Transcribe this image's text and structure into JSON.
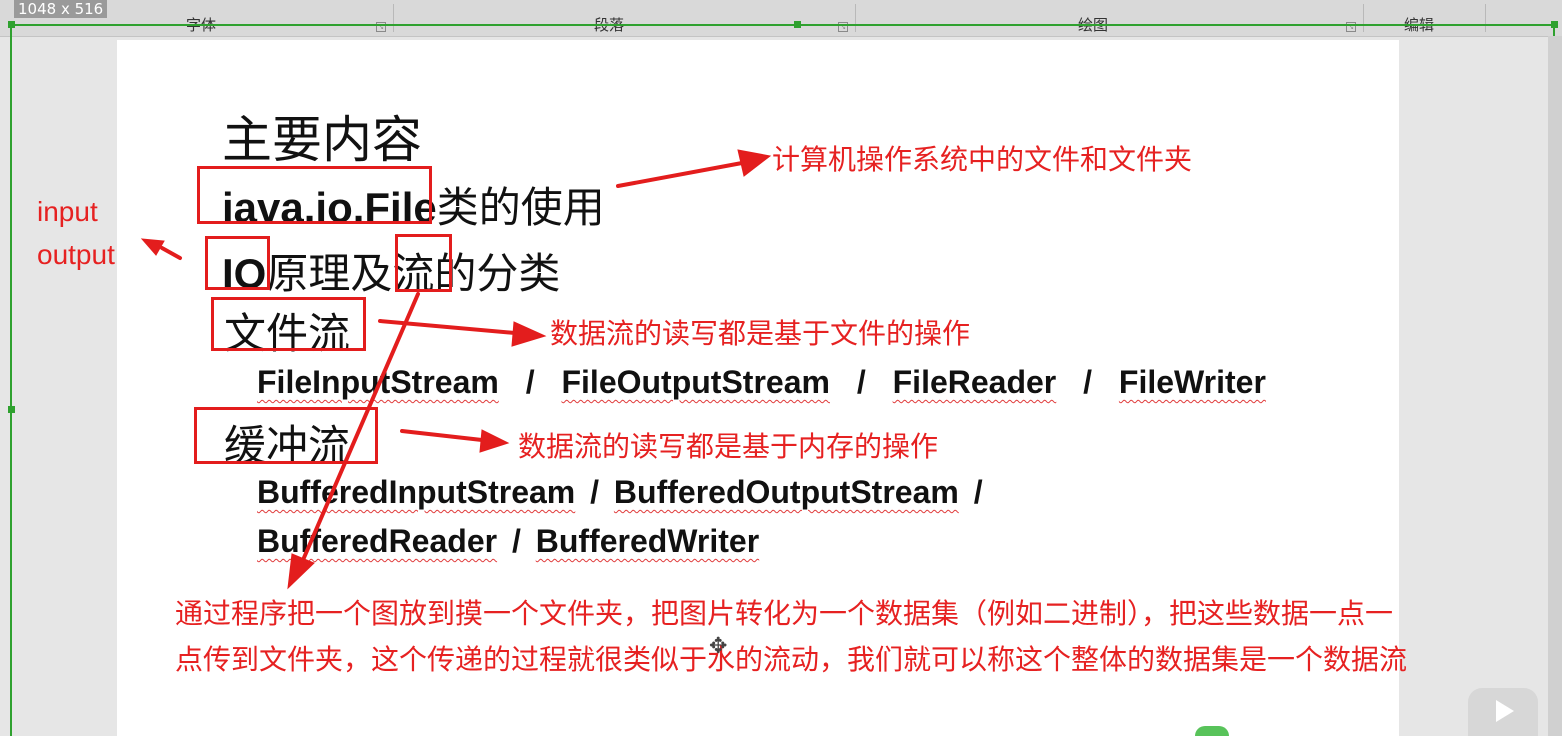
{
  "ribbon": {
    "size_readout": "1048 x 516",
    "groups": [
      "字体",
      "段落",
      "绘图",
      "编辑"
    ]
  },
  "slide": {
    "title": "主要内容",
    "item1": {
      "code": "iava.io.File",
      "rest": "类的使用"
    },
    "item2": {
      "io": "IO",
      "mid": "原理及",
      "flow": "流",
      "rest": "的分类"
    },
    "item3": "文件流",
    "file_streams": [
      "FileInputStream",
      "FileOutputStream",
      "FileReader",
      "FileWriter"
    ],
    "item4": "缓冲流",
    "buffered_line1": [
      "BufferedInputStream",
      "BufferedOutputStream"
    ],
    "buffered_line2": [
      "BufferedReader",
      "BufferedWriter"
    ],
    "slash": "/"
  },
  "annotations": {
    "file_note": "计算机操作系统中的文件和文件夹",
    "io_note_1": "input",
    "io_note_2": "output",
    "file_stream_note": "数据流的读写都是基于文件的操作",
    "buffered_note": "数据流的读写都是基于内存的操作",
    "bottom_note_1": "通过程序把一个图放到摸一个文件夹，把图片转化为一个数据集（例如二进制），把这些数据一点一",
    "bottom_note_2": "点传到文件夹，这个传递的过程就很类似于水的流动，我们就可以称这个整体的数据集是一个数据流"
  },
  "colors": {
    "annotation_red": "#e62121",
    "guide_green": "#2fa12f"
  },
  "icons": [
    "play-icon",
    "move-cursor-icon"
  ]
}
